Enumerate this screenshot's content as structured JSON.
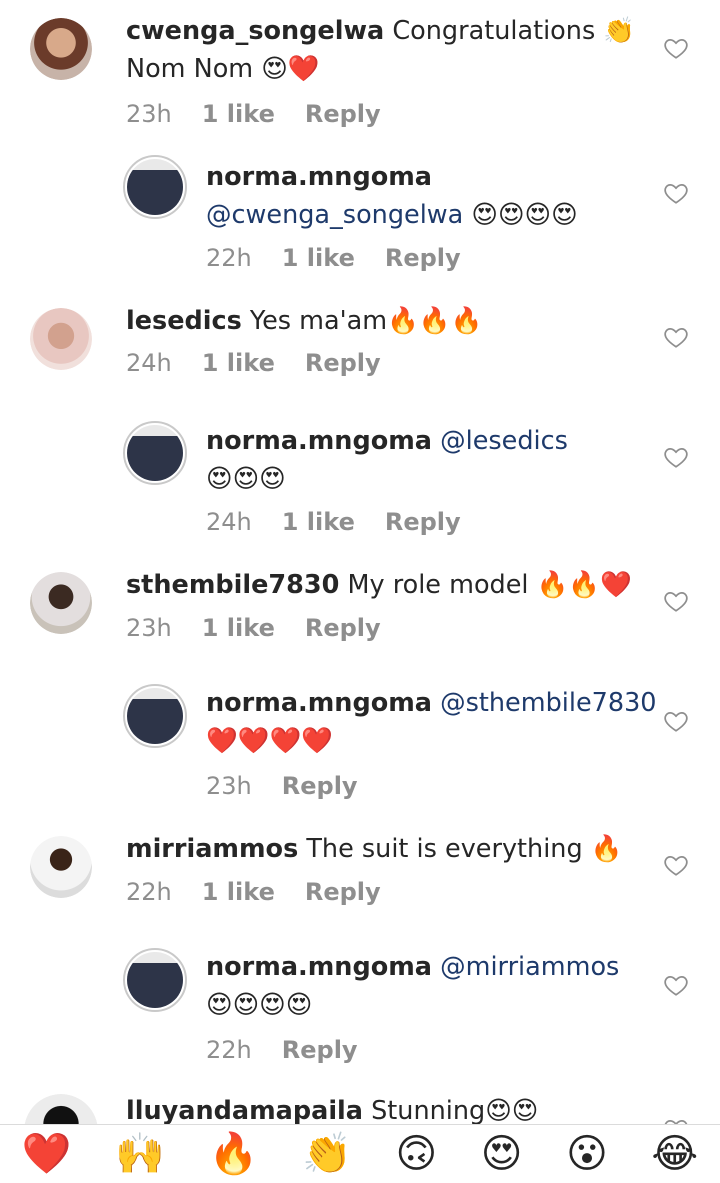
{
  "comments": [
    {
      "username": "cwenga_songelwa",
      "text": "Congratulations 👏",
      "line2": "Nom Nom 😍❤️",
      "time": "23h",
      "likes": "1 like",
      "reply": "Reply",
      "reply_to": ""
    },
    {
      "username": "norma.mngoma",
      "text": "",
      "mention": "@cwenga_songelwa",
      "emojis": "😍😍😍😍",
      "time": "22h",
      "likes": "1 like",
      "reply": "Reply"
    },
    {
      "username": "lesedics",
      "text": "Yes ma'am🔥🔥🔥",
      "time": "24h",
      "likes": "1 like",
      "reply": "Reply"
    },
    {
      "username": "norma.mngoma",
      "mention": "@lesedics",
      "emojis": "😍😍😍",
      "time": "24h",
      "likes": "1 like",
      "reply": "Reply"
    },
    {
      "username": "sthembile7830",
      "text": "My role model 🔥🔥❤️",
      "time": "23h",
      "likes": "1 like",
      "reply": "Reply"
    },
    {
      "username": "norma.mngoma",
      "mention": "@sthembile7830",
      "emojis": "❤️❤️❤️❤️",
      "time": "23h",
      "likes": "",
      "reply": "Reply"
    },
    {
      "username": "mirriammos",
      "text": "The suit is everything 🔥",
      "time": "22h",
      "likes": "1 like",
      "reply": "Reply"
    },
    {
      "username": "norma.mngoma",
      "mention": "@mirriammos",
      "emojis": "😍😍😍😍",
      "time": "22h",
      "likes": "",
      "reply": "Reply"
    },
    {
      "username": "lluyandamapaila",
      "text": "Stunning😍😍"
    }
  ],
  "reactions": [
    "❤️",
    "🙌",
    "🔥",
    "👏",
    "🙃",
    "😍",
    "😮",
    "😂"
  ],
  "colors": {
    "mention": "#1e3a6b",
    "meta": "#8e8e8e",
    "text": "#262626"
  },
  "icons": {
    "like": "heart-outline-icon"
  }
}
